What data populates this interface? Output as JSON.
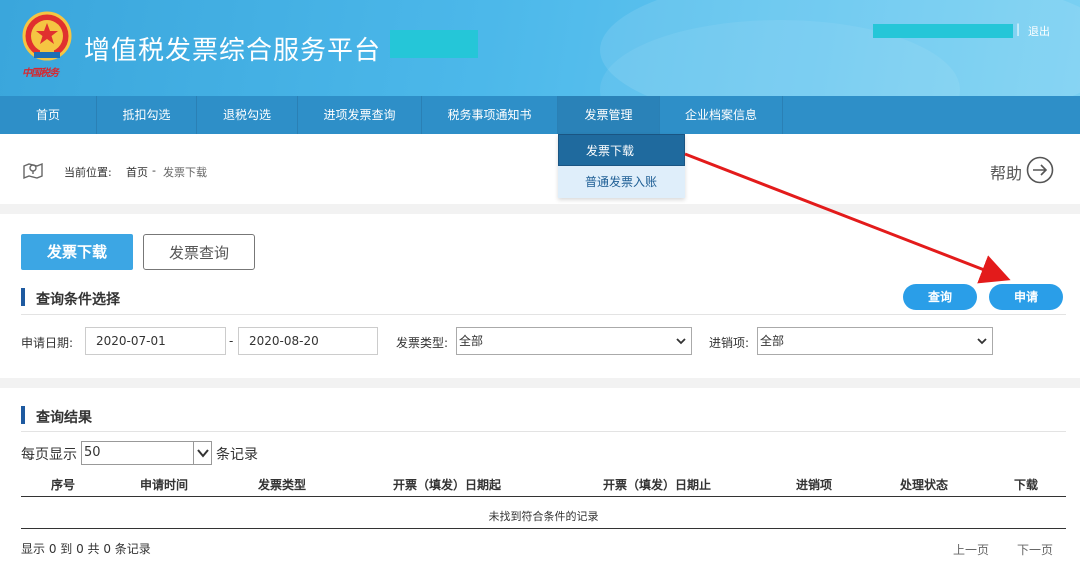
{
  "header": {
    "title": "增值税发票综合服务平台",
    "emblem_caption": "中国税务",
    "separator": "|",
    "logout_label": "退出"
  },
  "nav": {
    "items": [
      {
        "label": "首页"
      },
      {
        "label": "抵扣勾选"
      },
      {
        "label": "退税勾选"
      },
      {
        "label": "进项发票查询"
      },
      {
        "label": "税务事项通知书"
      },
      {
        "label": "发票管理"
      },
      {
        "label": "企业档案信息"
      }
    ],
    "active": "发票管理"
  },
  "dropdown": {
    "items": [
      {
        "label": "发票下载"
      },
      {
        "label": "普通发票入账"
      }
    ],
    "selected": "发票下载"
  },
  "breadcrumb": {
    "prefix": "当前位置:",
    "home": "首页",
    "separator": "-",
    "current": "发票下载"
  },
  "help": {
    "label": "帮助"
  },
  "tabs": {
    "download": "发票下载",
    "query": "发票查询"
  },
  "query_section": {
    "title": "查询条件选择",
    "query_button": "查询",
    "apply_button": "申请",
    "date_label": "申请日期:",
    "date_from": "2020-07-01",
    "date_separator": "-",
    "date_to": "2020-08-20",
    "invoice_type_label": "发票类型:",
    "invoice_type_value": "全部",
    "direction_label": "进销项:",
    "direction_value": "全部"
  },
  "results": {
    "title": "查询结果",
    "page_size_prefix": "每页显示",
    "page_size_value": "50",
    "page_size_suffix": "条记录",
    "columns": [
      "序号",
      "申请时间",
      "发票类型",
      "开票（填发）日期起",
      "开票（填发）日期止",
      "进销项",
      "处理状态",
      "下载"
    ],
    "empty_message": "未找到符合条件的记录",
    "summary": "显示 0 到 0 共 0 条记录",
    "prev_label": "上一页",
    "next_label": "下一页"
  },
  "colors": {
    "header_gradient_start": "#3aa6dc",
    "nav_bg": "#2e8fc8",
    "primary_button": "#3ca6e4",
    "pill_button": "#2a9ee8",
    "section_accent": "#1e5aa0",
    "annotation_arrow": "#e31b1b",
    "emblem_red": "#d8262e"
  }
}
